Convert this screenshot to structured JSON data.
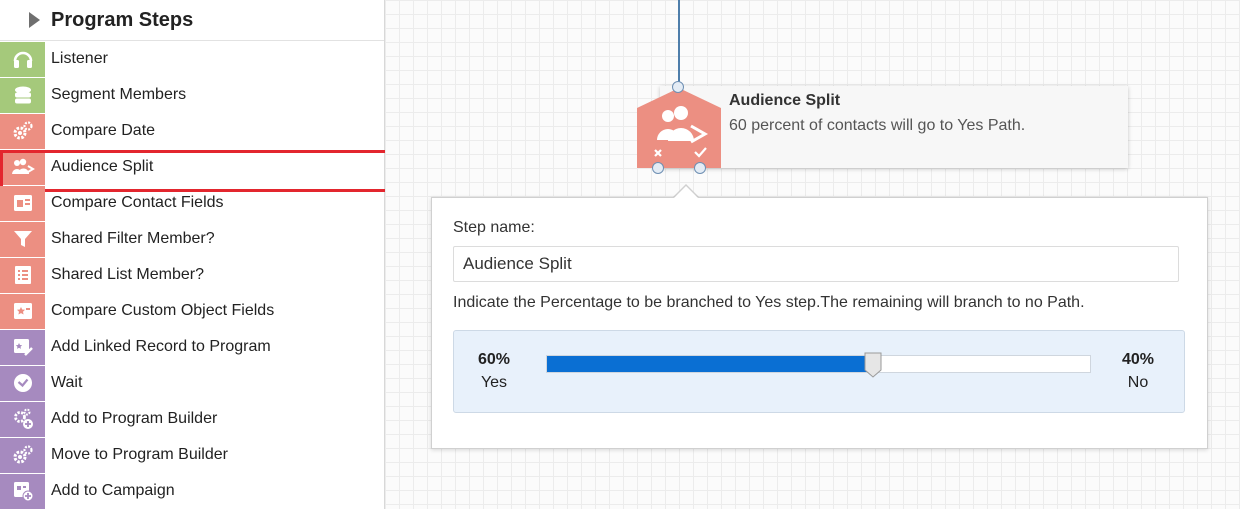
{
  "sidebar": {
    "title": "Program Steps",
    "items": [
      {
        "label": "Listener",
        "icon": "headphones-icon",
        "color": "green"
      },
      {
        "label": "Segment Members",
        "icon": "segment-stack-icon",
        "color": "green"
      },
      {
        "label": "Compare Date",
        "icon": "gears-icon",
        "color": "red"
      },
      {
        "label": "Audience Split",
        "icon": "audience-split-icon",
        "color": "red",
        "selected": true
      },
      {
        "label": "Compare Contact Fields",
        "icon": "contact-card-icon",
        "color": "red"
      },
      {
        "label": "Shared Filter Member?",
        "icon": "filter-funnel-icon",
        "color": "red"
      },
      {
        "label": "Shared List Member?",
        "icon": "checklist-icon",
        "color": "red"
      },
      {
        "label": "Compare Custom Object Fields",
        "icon": "custom-object-card-icon",
        "color": "red"
      },
      {
        "label": "Add Linked Record to Program",
        "icon": "linked-record-icon",
        "color": "purple"
      },
      {
        "label": "Wait",
        "icon": "clock-icon",
        "color": "purple"
      },
      {
        "label": "Add to Program Builder",
        "icon": "gears-plus-icon",
        "color": "purple"
      },
      {
        "label": "Move to Program Builder",
        "icon": "gears-move-icon",
        "color": "purple"
      },
      {
        "label": "Add to Campaign",
        "icon": "campaign-add-icon",
        "color": "purple"
      }
    ]
  },
  "node": {
    "title": "Audience Split",
    "description": "60 percent of contacts will go to Yes Path."
  },
  "popover": {
    "step_name_label": "Step name:",
    "step_name_value": "Audience Split",
    "instruction": "Indicate the Percentage to be branched to Yes step.The remaining will branch to no Path.",
    "yes_percent": "60%",
    "yes_label": "Yes",
    "no_percent": "40%",
    "no_label": "No",
    "split_fraction": 0.6
  },
  "colors": {
    "green": "#a5c97b",
    "red": "#ec8f82",
    "purple": "#a68abf",
    "slider_fill": "#0a6fd3",
    "selection_outline": "#e3262e"
  }
}
